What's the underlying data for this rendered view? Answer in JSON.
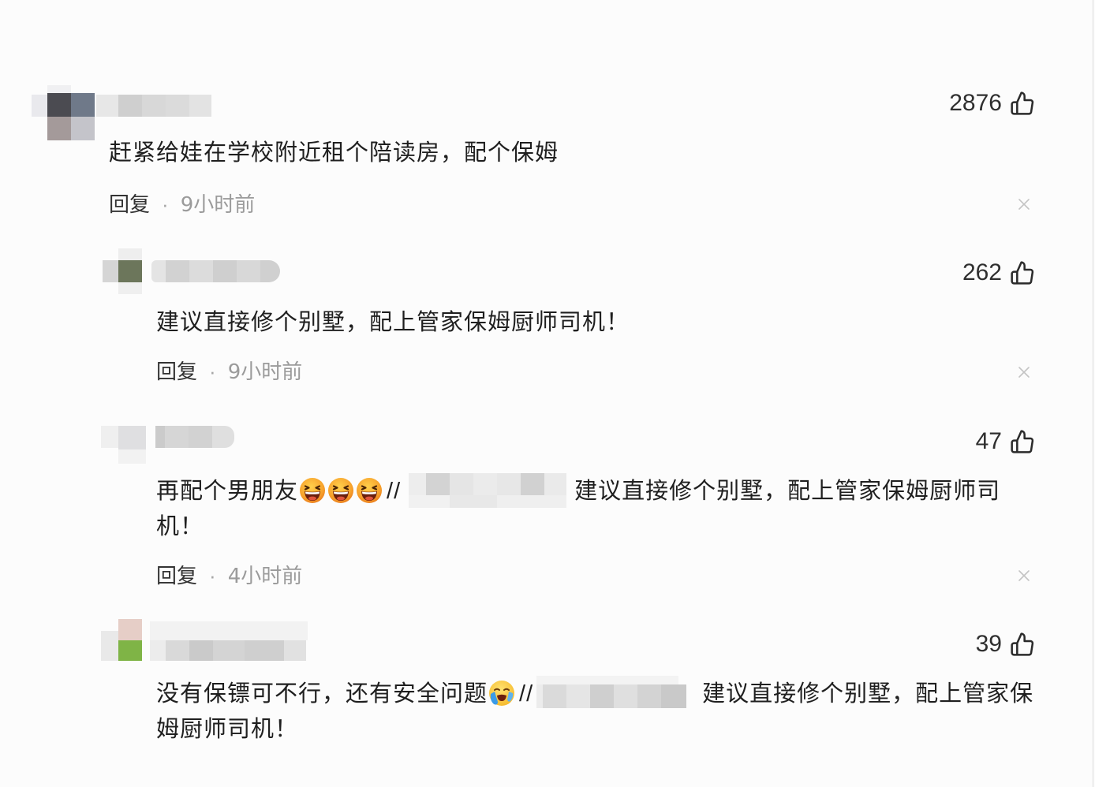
{
  "icons": {
    "like": "thumbs-up-icon",
    "close": "close-icon",
    "emoji_laugh": "laughing-emoji-icon",
    "emoji_tears": "tearful-emoji-icon"
  },
  "comments": [
    {
      "likes": "2876",
      "text": "赶紧给娃在学校附近租个陪读房，配个保姆",
      "reply": "回复",
      "dot": "·",
      "time": "9小时前"
    },
    {
      "likes": "262",
      "text": "建议直接修个别墅，配上管家保姆厨师司机！",
      "reply": "回复",
      "dot": "·",
      "time": "9小时前"
    },
    {
      "likes": "47",
      "text_before": "再配个男朋友",
      "emojis": [
        "laughing-emoji-icon",
        "laughing-emoji-icon",
        "laughing-emoji-icon"
      ],
      "repost_sep": "//",
      "quoted": "建议直接修个别墅，配上管家保姆厨师司机！",
      "reply": "回复",
      "dot": "·",
      "time": "4小时前"
    },
    {
      "likes": "39",
      "text_before": "没有保镖可不行，还有安全问题",
      "emojis": [
        "tearful-emoji-icon"
      ],
      "repost_sep": "//",
      "quoted": "建议直接修个别墅，配上管家保姆厨师司机！"
    }
  ]
}
